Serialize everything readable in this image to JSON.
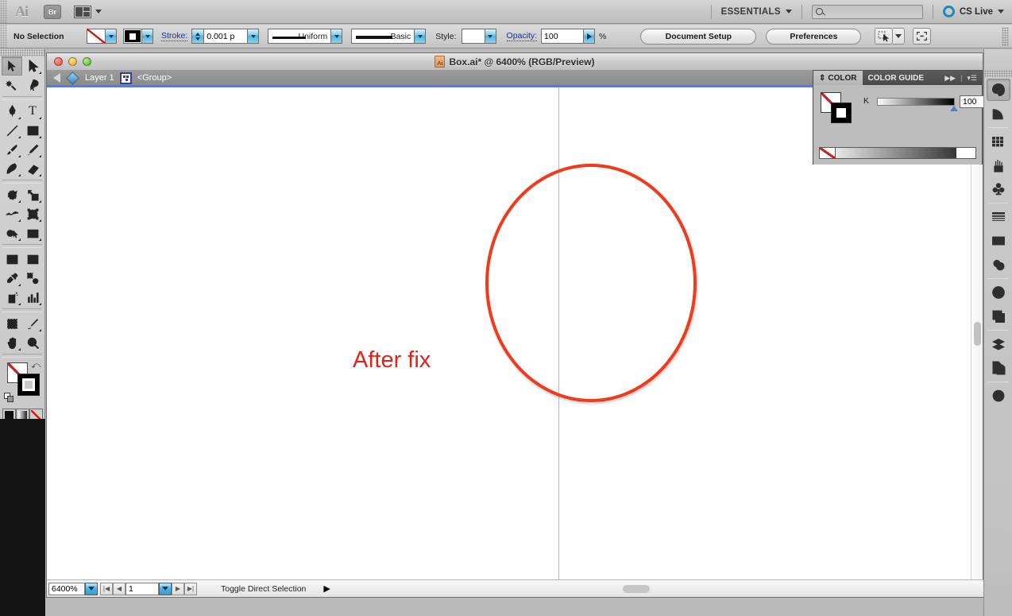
{
  "app": {
    "logo": "Ai",
    "bridge_label": "Br",
    "arrange_icon": "arrange-documents-icon",
    "workspace": "ESSENTIALS",
    "search_placeholder": "",
    "search_value": "",
    "cs_live": "CS Live"
  },
  "control_bar": {
    "selection_status": "No Selection",
    "fill_swatch": "none-fill-swatch",
    "stroke_swatch": "black-stroke-swatch",
    "stroke_label": "Stroke:",
    "stroke_weight": "0.001 p",
    "variable_width_profile": "Uniform",
    "brush_definition": "Basic",
    "style_label": "Style:",
    "opacity_label": "Opacity:",
    "opacity_value": "100",
    "percent": "%",
    "document_setup": "Document Setup",
    "preferences": "Preferences",
    "select_similar_icon": "select-similar-objects-icon",
    "align_icon": "align-to-selection-icon"
  },
  "toolbar": {
    "tools": [
      {
        "name": "selection-tool",
        "selected": true
      },
      {
        "name": "direct-selection-tool",
        "selected": false
      },
      {
        "name": "magic-wand-tool",
        "selected": false
      },
      {
        "name": "lasso-tool",
        "selected": false
      },
      {
        "name": "pen-tool",
        "selected": false
      },
      {
        "name": "type-tool",
        "selected": false
      },
      {
        "name": "line-segment-tool",
        "selected": false
      },
      {
        "name": "rectangle-tool",
        "selected": false
      },
      {
        "name": "paintbrush-tool",
        "selected": false
      },
      {
        "name": "pencil-tool",
        "selected": false
      },
      {
        "name": "blob-brush-tool",
        "selected": false
      },
      {
        "name": "eraser-tool",
        "selected": false
      },
      {
        "name": "rotate-tool",
        "selected": false
      },
      {
        "name": "scale-tool",
        "selected": false
      },
      {
        "name": "width-tool",
        "selected": false
      },
      {
        "name": "free-transform-tool",
        "selected": false
      },
      {
        "name": "shape-builder-tool",
        "selected": false
      },
      {
        "name": "perspective-grid-tool",
        "selected": false
      },
      {
        "name": "mesh-tool",
        "selected": false
      },
      {
        "name": "gradient-tool",
        "selected": false
      },
      {
        "name": "eyedropper-tool",
        "selected": false
      },
      {
        "name": "blend-tool",
        "selected": false
      },
      {
        "name": "symbol-sprayer-tool",
        "selected": false
      },
      {
        "name": "column-graph-tool",
        "selected": false
      },
      {
        "name": "artboard-tool",
        "selected": false
      },
      {
        "name": "slice-tool",
        "selected": false
      },
      {
        "name": "hand-tool",
        "selected": false
      },
      {
        "name": "zoom-tool",
        "selected": false
      }
    ],
    "fill_stroke": {
      "fill": "none",
      "stroke": "black",
      "swap_icon": "swap-fill-stroke-icon",
      "default_icon": "default-fill-stroke-icon"
    },
    "color_modes": [
      "color-mode",
      "gradient-mode",
      "none-mode"
    ],
    "draw_modes": [
      "draw-normal",
      "draw-behind",
      "draw-inside"
    ],
    "screen_mode": "change-screen-mode"
  },
  "document": {
    "title": "Box.ai* @ 6400% (RGB/Preview)",
    "traffic_lights": [
      "close",
      "minimize",
      "zoom"
    ],
    "layer_name": "Layer 1",
    "group_name": "<Group>",
    "back_arrow": "navigate-back-arrow"
  },
  "canvas": {
    "artwork_text": "After fix",
    "artwork_text_color": "#e02217",
    "ellipse_stroke_color": "#f1391c",
    "artboard_edge_color": "#b9b9b9"
  },
  "status_bar": {
    "zoom_level": "6400%",
    "page_number": "1",
    "status_label": "Toggle Direct Selection",
    "first_icon": "first-artboard-icon",
    "prev_icon": "previous-artboard-icon",
    "next_icon": "next-artboard-icon",
    "last_icon": "last-artboard-icon"
  },
  "color_panel": {
    "tabs": [
      {
        "label": "COLOR",
        "active": true
      },
      {
        "label": "COLOR GUIDE",
        "active": false
      }
    ],
    "collapse_icon": "collapse-to-icons-icon",
    "menu_icon": "panel-menu-icon",
    "channel_label": "K",
    "channel_value": "100",
    "percent": "%",
    "fill_swatch": "none-fill-swatch",
    "stroke_swatch": "black-stroke-swatch"
  },
  "dock": {
    "buttons": [
      {
        "name": "color-panel-icon",
        "selected": true
      },
      {
        "name": "color-guide-panel-icon",
        "selected": false
      },
      {
        "name": "swatches-panel-icon",
        "selected": false
      },
      {
        "name": "brushes-panel-icon",
        "selected": false
      },
      {
        "name": "symbols-panel-icon",
        "selected": false
      },
      {
        "name": "stroke-panel-icon",
        "selected": false
      },
      {
        "name": "gradient-panel-icon",
        "selected": false
      },
      {
        "name": "transparency-panel-icon",
        "selected": false
      },
      {
        "name": "appearance-panel-icon",
        "selected": false
      },
      {
        "name": "graphic-styles-panel-icon",
        "selected": false
      },
      {
        "name": "layers-panel-icon",
        "selected": false
      },
      {
        "name": "artboards-panel-icon",
        "selected": false
      },
      {
        "name": "document-info-panel-icon",
        "selected": false
      }
    ]
  }
}
